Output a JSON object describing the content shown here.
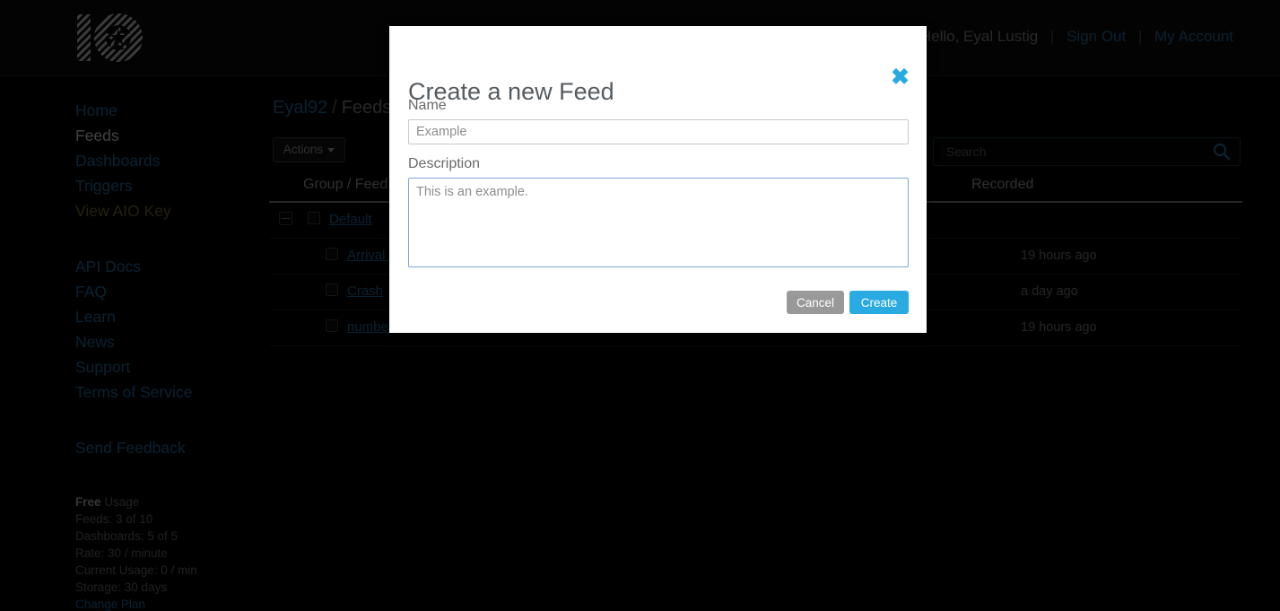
{
  "brand": {
    "logo_alt": "Adafruit IO logo"
  },
  "topnav": {
    "greeting": "Hello, Eyal Lustig",
    "separator": "|",
    "sign_out": "Sign Out",
    "my_account": "My Account"
  },
  "sidebar": {
    "primary": [
      {
        "label": "Home",
        "state": "link"
      },
      {
        "label": "Feeds",
        "state": "active"
      },
      {
        "label": "Dashboards",
        "state": "link"
      },
      {
        "label": "Triggers",
        "state": "link"
      },
      {
        "label": "View AIO Key",
        "state": "key"
      }
    ],
    "secondary": [
      {
        "label": "API Docs"
      },
      {
        "label": "FAQ"
      },
      {
        "label": "Learn"
      },
      {
        "label": "News"
      },
      {
        "label": "Support"
      },
      {
        "label": "Terms of Service"
      }
    ],
    "feedback": {
      "label": "Send Feedback"
    },
    "usage": {
      "plan": "Free",
      "plan_suffix": " Usage",
      "feeds": "Feeds: 3 of 10",
      "dashboards": "Dashboards: 5 of 5",
      "rate": "Rate: 30 / minute",
      "current_usage": "Current Usage: 0 / min",
      "storage": "Storage: 30 days",
      "change_plan": "Change Plan"
    }
  },
  "main": {
    "breadcrumb": {
      "user": "Eyal92",
      "slash": "/",
      "section": "Feeds"
    },
    "actions_button": "Actions",
    "search": {
      "placeholder": "Search",
      "value": ""
    },
    "table": {
      "columns": [
        "Group / Feed",
        "Recorded"
      ],
      "rows": [
        {
          "type": "group",
          "name": "Default",
          "recorded": ""
        },
        {
          "type": "feed",
          "name": "Arrival t",
          "recorded": "19 hours ago"
        },
        {
          "type": "feed",
          "name": "Crash",
          "recorded": "a day ago"
        },
        {
          "type": "feed",
          "name": "number",
          "recorded": "19 hours ago"
        }
      ]
    }
  },
  "modal": {
    "title": "Create a new Feed",
    "close_glyph": "✖",
    "name_label": "Name",
    "name_value": "Example",
    "name_placeholder": "Example",
    "description_label": "Description",
    "description_value": "This is an example.",
    "cancel_label": "Cancel",
    "create_label": "Create"
  },
  "colors": {
    "accent_blue": "#29abe2",
    "link_blue": "#2a7fb8",
    "cancel_gray": "#999999",
    "modal_bg": "#ffffff",
    "page_bg": "#000000"
  }
}
